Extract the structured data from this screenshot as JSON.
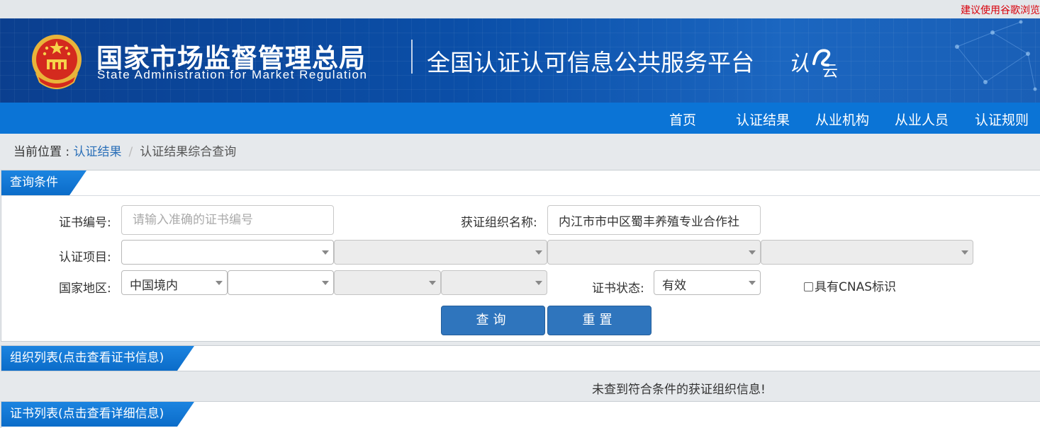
{
  "top_notice": "建议使用谷歌浏览",
  "header": {
    "agency_cn": "国家市场监督管理总局",
    "agency_en": "State Administration  for  Market Regulation",
    "platform_title": "全国认证认可信息公共服务平台",
    "brand_logo_text": "认云",
    "emblem_icon": "national-emblem-icon",
    "colors": {
      "banner": "#0b4fa8",
      "navbar": "#0b74d6",
      "accent": "#2f75bd",
      "notice": "#d9000b"
    }
  },
  "nav": {
    "items": [
      {
        "label": "首页"
      },
      {
        "label": "认证结果"
      },
      {
        "label": "从业机构"
      },
      {
        "label": "从业人员"
      },
      {
        "label": "认证规则"
      }
    ]
  },
  "breadcrumb": {
    "prefix": "当前位置 : ",
    "link": "认证结果",
    "separator": "/",
    "current": "认证结果综合查询"
  },
  "query_panel": {
    "title": "查询条件",
    "cert_no_label": "证书编号:",
    "cert_no_placeholder": "请输入准确的证书编号",
    "org_name_label": "获证组织名称:",
    "org_name_value": "内江市市中区蜀丰养殖专业合作社",
    "cert_item_label": "认证项目:",
    "cert_item_selects": [
      "",
      "",
      "",
      ""
    ],
    "region_label": "国家地区:",
    "region_selects": [
      "中国境内",
      "",
      "",
      ""
    ],
    "status_label": "证书状态:",
    "status_value": "有效",
    "cnas_label": "具有CNAS标识",
    "search_button": "查询",
    "reset_button": "重置"
  },
  "org_panel": {
    "title": "组织列表(点击查看证书信息)",
    "empty_message": "未查到符合条件的获证组织信息!"
  },
  "cert_panel": {
    "title": "证书列表(点击查看详细信息)"
  }
}
